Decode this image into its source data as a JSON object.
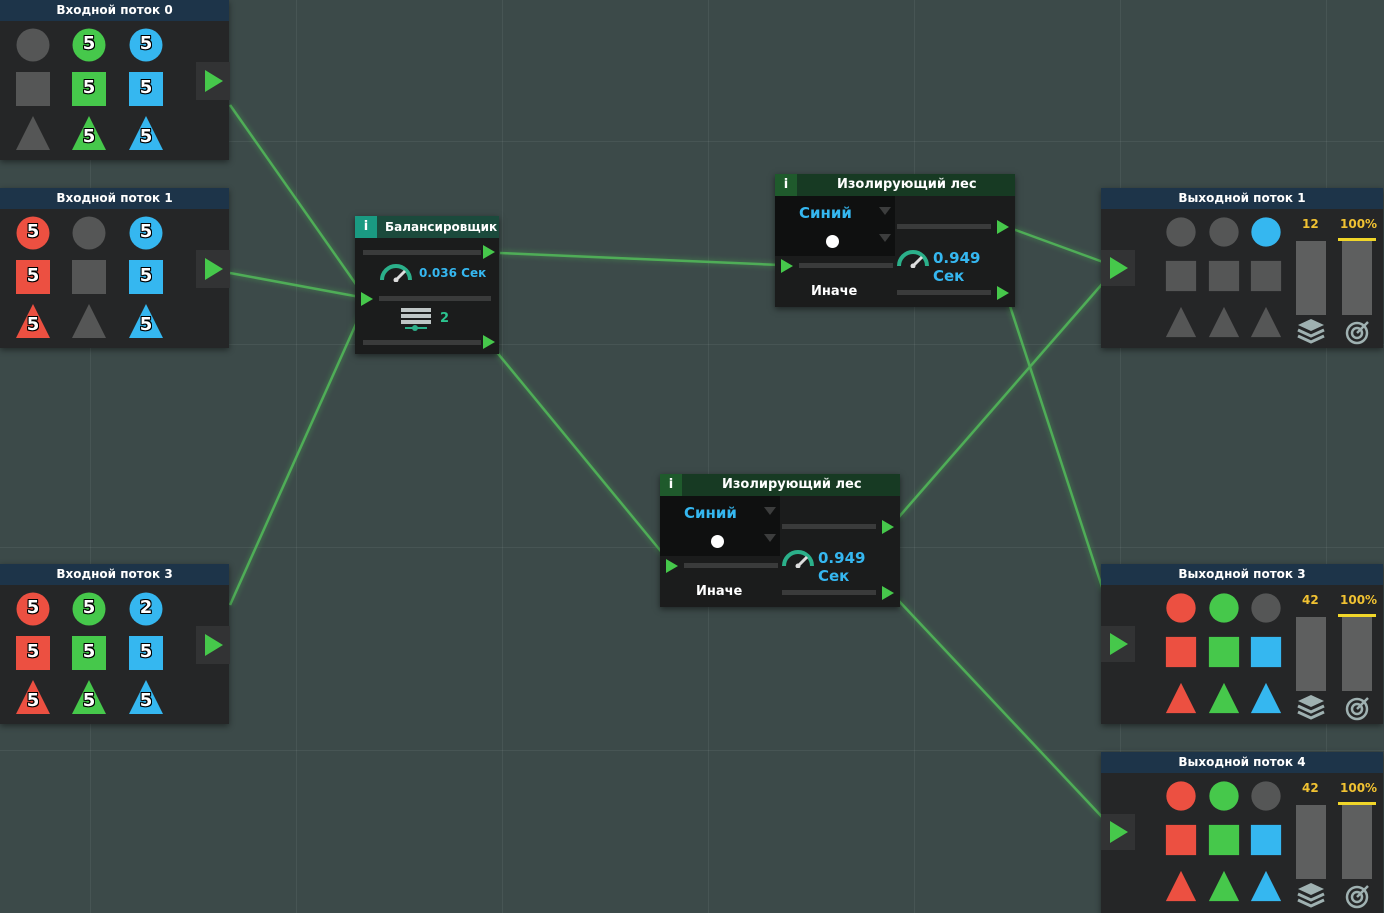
{
  "inputs": [
    {
      "title": "Входной поток 0",
      "counts": [
        "",
        "5",
        "5",
        "",
        "5",
        "5",
        "",
        "5",
        "5"
      ]
    },
    {
      "title": "Входной поток 1",
      "counts": [
        "5",
        "",
        "5",
        "5",
        "",
        "5",
        "5",
        "",
        "5"
      ]
    },
    {
      "title": "Входной поток 3",
      "counts": [
        "5",
        "5",
        "2",
        "5",
        "5",
        "5",
        "5",
        "5",
        "5"
      ]
    }
  ],
  "balancer": {
    "title": "Балансировщик",
    "info": "i",
    "speed": "0.036 Сек",
    "count": "2"
  },
  "forests": [
    {
      "title": "Изолирующий лес",
      "info": "i",
      "filter": "Синий",
      "speed": "0.949 Сек",
      "else_label": "Иначе"
    },
    {
      "title": "Изолирующий лес",
      "info": "i",
      "filter": "Синий",
      "speed": "0.949 Сек",
      "else_label": "Иначе"
    }
  ],
  "outputs": [
    {
      "title": "Выходной поток 1",
      "amount": "12",
      "percent": "100%",
      "active": [
        "gray",
        "gray",
        "blue",
        "gray",
        "gray",
        "gray",
        "gray",
        "gray",
        "gray"
      ],
      "level": 0.0
    },
    {
      "title": "Выходной поток 3",
      "amount": "42",
      "percent": "100%",
      "active": [
        "red",
        "green",
        "gray",
        "red",
        "green",
        "blue",
        "red",
        "green",
        "blue"
      ],
      "level": 0.0
    },
    {
      "title": "Выходной поток 4",
      "amount": "42",
      "percent": "100%",
      "active": [
        "red",
        "green",
        "gray",
        "red",
        "green",
        "blue",
        "red",
        "green",
        "blue"
      ],
      "level": 0.0
    }
  ],
  "icons": {
    "play": "play-triangle-icon",
    "gauge": "speed-gauge-icon",
    "stack": "stack-layers-icon",
    "target": "target-icon",
    "bars": "list-bars-icon",
    "dot": "white-dot-icon"
  },
  "colors": {
    "red": "#ec5041",
    "green": "#46c84b",
    "blue": "#35b7f0",
    "gray": "#555656",
    "wire": "#52b859",
    "header": "#1d3449",
    "node_head": "#173a23",
    "badge_teal": "#1a9a82",
    "accent_yellow": "#f1c232"
  }
}
